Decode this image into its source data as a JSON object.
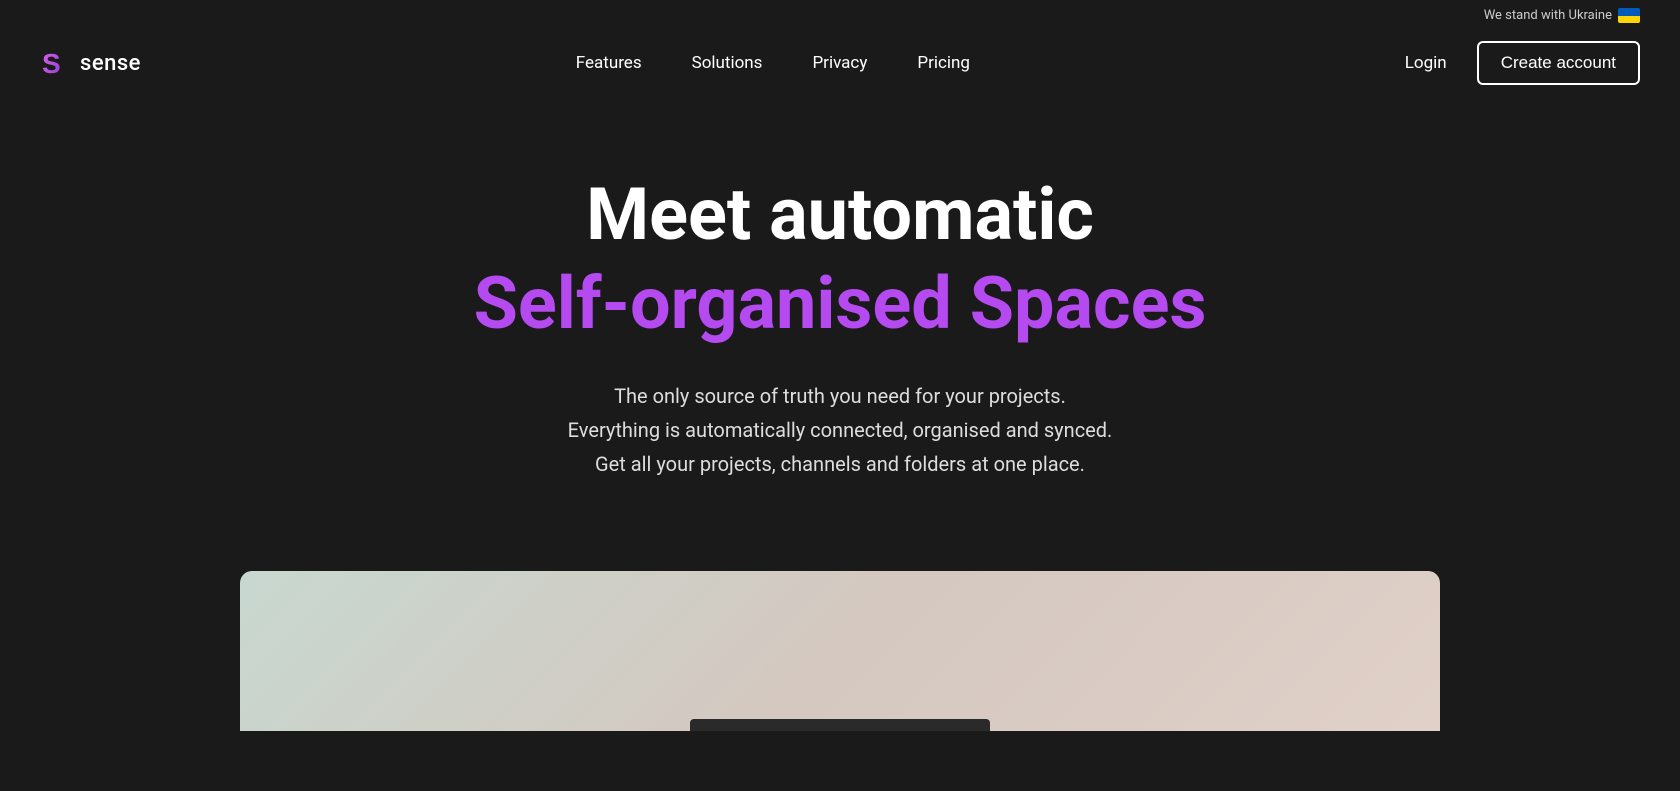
{
  "topBanner": {
    "ukraine_text": "We stand with Ukraine"
  },
  "nav": {
    "logo": {
      "text": "sense"
    },
    "links": [
      {
        "id": "features",
        "label": "Features"
      },
      {
        "id": "solutions",
        "label": "Solutions"
      },
      {
        "id": "privacy",
        "label": "Privacy"
      },
      {
        "id": "pricing",
        "label": "Pricing"
      }
    ],
    "login_label": "Login",
    "create_account_label": "Create account"
  },
  "hero": {
    "title_line1": "Meet automatic",
    "title_line2": "Self-organised Spaces",
    "description_line1": "The only source of truth you need for your projects.",
    "description_line2": "Everything is automatically connected, organised and synced.",
    "description_line3": "Get all your projects, channels and folders at one place."
  },
  "colors": {
    "background": "#1a1a1a",
    "accent_purple": "#b44af0",
    "text_white": "#ffffff",
    "text_muted": "#dddddd"
  }
}
